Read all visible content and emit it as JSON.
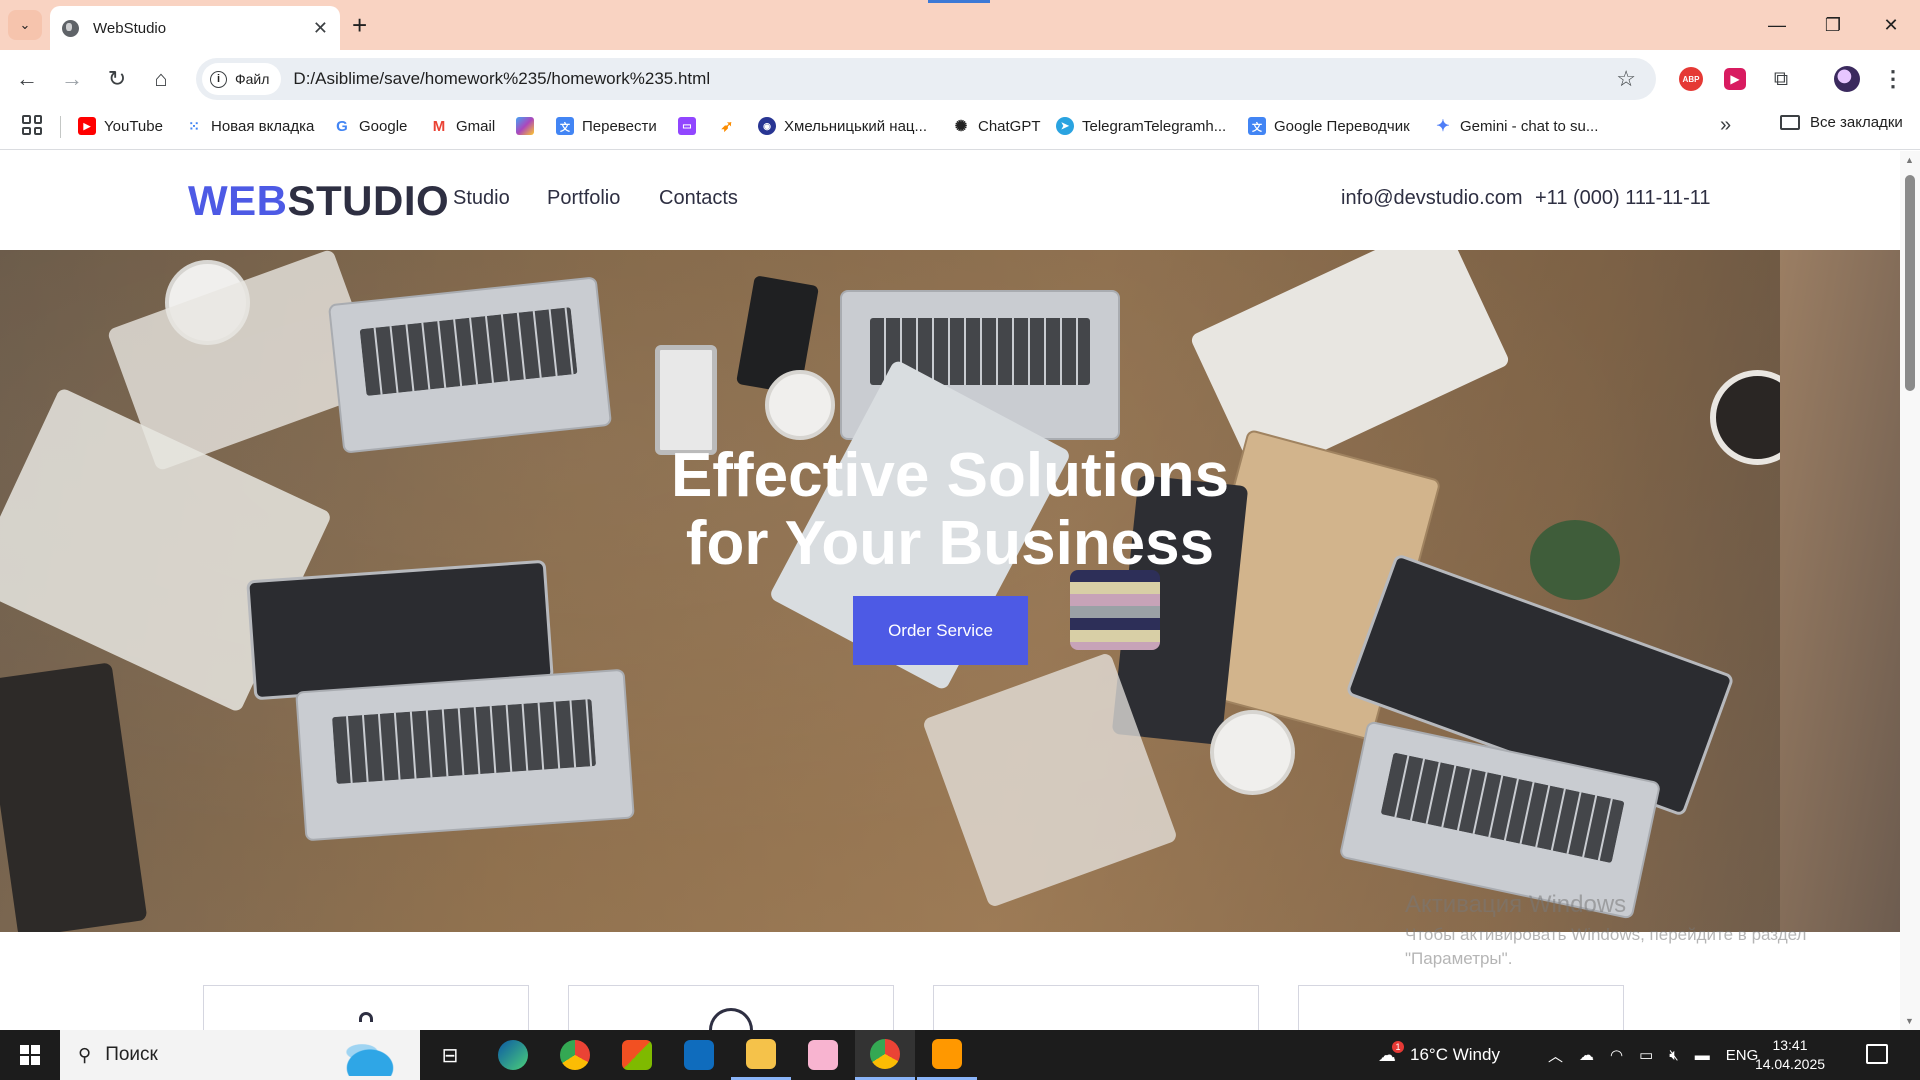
{
  "browser": {
    "tab_title": "WebStudio",
    "new_tab_symbol": "+",
    "close_tab_symbol": "✕",
    "omnibox": {
      "chip_label": "Файл",
      "url": "D:/Asiblime/save/homework%235/homework%235.html"
    },
    "bookmarks": [
      {
        "label": "YouTube",
        "icon": "youtube-icon",
        "color": "#ff0000"
      },
      {
        "label": "Новая вкладка",
        "icon": "apps-dots-icon",
        "color": "#4285f4"
      },
      {
        "label": "Google",
        "icon": "google-icon",
        "color": "#4285f4"
      },
      {
        "label": "Gmail",
        "icon": "gmail-icon",
        "color": "#ea4335"
      },
      {
        "label": "",
        "icon": "color-app-icon",
        "color": "#7e57c2"
      },
      {
        "label": "Перевести",
        "icon": "translate-icon",
        "color": "#4285f4"
      },
      {
        "label": "",
        "icon": "twitch-icon",
        "color": "#9146ff"
      },
      {
        "label": "",
        "icon": "rocket-icon",
        "color": "#fb8c00"
      },
      {
        "label": "Хмельницький нац...",
        "icon": "university-icon",
        "color": "#283593"
      },
      {
        "label": "ChatGPT",
        "icon": "chatgpt-icon",
        "color": "#222222"
      },
      {
        "label": "TelegramTelegramh...",
        "icon": "telegram-icon",
        "color": "#2aa3e0"
      },
      {
        "label": "Google Переводчик",
        "icon": "translate-icon",
        "color": "#4285f4"
      },
      {
        "label": "Gemini - chat to su...",
        "icon": "gemini-icon",
        "color": "#4f7ef7"
      }
    ],
    "more_bookmarks": "»",
    "all_bookmarks_label": "Все закладки"
  },
  "site": {
    "logo_part1": "WEB",
    "logo_part2": "STUDIO",
    "nav": [
      "Studio",
      "Portfolio",
      "Contacts"
    ],
    "email": "info@devstudio.com",
    "phone": "+11 (000) 111-11-11",
    "hero_title_line1": "Effective Solutions",
    "hero_title_line2": "for Your Business",
    "cta_label": "Order Service",
    "brand_color": "#4d5ae5",
    "text_color": "#2e2f42"
  },
  "watermark": {
    "title": "Активация Windows",
    "text": "Чтобы активировать Windows, перейдите в раздел \"Параметры\"."
  },
  "taskbar": {
    "search_placeholder": "Поиск",
    "weather": "16°C  Windy",
    "weather_badge": "1",
    "language": "ENG",
    "time": "13:41",
    "date": "14.04.2025"
  }
}
